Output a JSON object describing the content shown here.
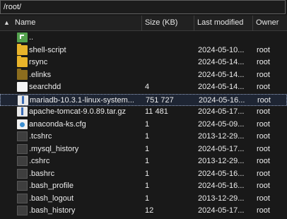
{
  "path": "/root/",
  "columns": {
    "name": "Name",
    "size": "Size (KB)",
    "modified": "Last modified",
    "owner": "Owner"
  },
  "files": [
    {
      "name": "..",
      "size": "",
      "modified": "",
      "owner": "",
      "icon": "parent-folder-icon"
    },
    {
      "name": "shell-script",
      "size": "",
      "modified": "2024-05-10...",
      "owner": "root",
      "icon": "folder-icon"
    },
    {
      "name": "rsync",
      "size": "",
      "modified": "2024-05-14...",
      "owner": "root",
      "icon": "folder-icon"
    },
    {
      "name": ".elinks",
      "size": "",
      "modified": "2024-05-14...",
      "owner": "root",
      "icon": "hidden-folder-icon"
    },
    {
      "name": "searchdd",
      "size": "4",
      "modified": "2024-05-14...",
      "owner": "root",
      "icon": "file-icon"
    },
    {
      "name": "mariadb-10.3.1-linux-system...",
      "size": "751 727",
      "modified": "2024-05-16...",
      "owner": "root",
      "icon": "archive-icon",
      "selected": true
    },
    {
      "name": "apache-tomcat-9.0.89.tar.gz",
      "size": "11 481",
      "modified": "2024-05-17...",
      "owner": "root",
      "icon": "archive-icon"
    },
    {
      "name": "anaconda-ks.cfg",
      "size": "1",
      "modified": "2024-05-09...",
      "owner": "root",
      "icon": "config-file-icon"
    },
    {
      "name": ".tcshrc",
      "size": "1",
      "modified": "2013-12-29...",
      "owner": "root",
      "icon": "hidden-file-icon"
    },
    {
      "name": ".mysql_history",
      "size": "1",
      "modified": "2024-05-17...",
      "owner": "root",
      "icon": "hidden-file-icon"
    },
    {
      "name": ".cshrc",
      "size": "1",
      "modified": "2013-12-29...",
      "owner": "root",
      "icon": "hidden-file-icon"
    },
    {
      "name": ".bashrc",
      "size": "1",
      "modified": "2024-05-16...",
      "owner": "root",
      "icon": "hidden-file-icon"
    },
    {
      "name": ".bash_profile",
      "size": "1",
      "modified": "2024-05-16...",
      "owner": "root",
      "icon": "hidden-file-icon"
    },
    {
      "name": ".bash_logout",
      "size": "1",
      "modified": "2013-12-29...",
      "owner": "root",
      "icon": "hidden-file-icon"
    },
    {
      "name": ".bash_history",
      "size": "12",
      "modified": "2024-05-17...",
      "owner": "root",
      "icon": "hidden-file-icon"
    }
  ]
}
